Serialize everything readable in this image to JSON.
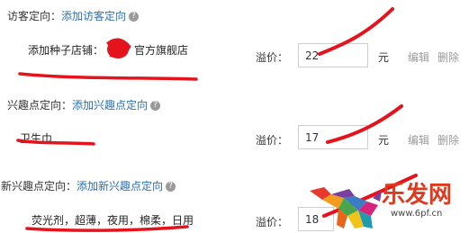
{
  "sections": [
    {
      "label": "访客定向：",
      "link": "添加访客定向",
      "item": "添加种子店铺：",
      "item_suffix": "官方旗舰店",
      "premium_label": "溢价：",
      "premium_value": "22",
      "unit": "元",
      "edit": "编辑",
      "delete": "删除"
    },
    {
      "label": "兴趣点定向：",
      "link": "添加兴趣点定向",
      "item": "卫生巾",
      "premium_label": "溢价：",
      "premium_value": "17",
      "unit": "元",
      "edit": "编辑",
      "delete": "删除"
    },
    {
      "label": "新兴趣点定向：",
      "link": "添加新兴趣点定向",
      "item": "荧光剂，超薄，夜用，棉柔，日用",
      "premium_label": "溢价：",
      "premium_value": "18"
    }
  ],
  "help_icon": "question-circle-icon",
  "watermark": {
    "brand": "乐发网",
    "url": "www.6pf.cn",
    "icon": "bull-logo-icon"
  },
  "colors": {
    "link": "#2a6fb6",
    "annotation": "#e5141c",
    "help": "#9a9a9a"
  }
}
